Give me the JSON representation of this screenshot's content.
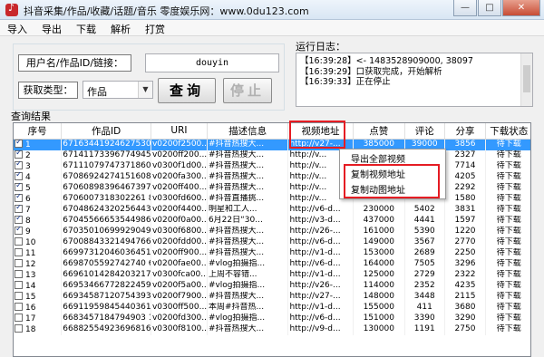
{
  "window": {
    "title": "抖音采集/作品/收藏/话题/音乐    零度娱乐网：www.0du123.com",
    "controls": [
      "—",
      "□",
      "✕"
    ]
  },
  "menu": [
    "导入",
    "导出",
    "下载",
    "解析",
    "打赏"
  ],
  "form": {
    "url_label": "用户名/作品ID/链接：",
    "url_value": "douyin",
    "type_label": "获取类型：",
    "type_value": "作品",
    "query_button": "查询",
    "stop_button": "停止"
  },
  "log": {
    "caption": "运行日志：",
    "lines": [
      "【16:39:28】<- 1483528909000, 38097",
      "【16:39:29】口获取完成，开始解析",
      "【16:39:33】正在停止"
    ]
  },
  "results": {
    "caption": "查询结果",
    "columns": [
      "序号",
      "作品ID",
      "URI",
      "描述信息",
      "视频地址",
      "点赞",
      "评论",
      "分享",
      "下载状态"
    ],
    "rows": [
      {
        "idx": "1",
        "checked": true,
        "id": "6716344192462753035",
        "uri": "v0200f2500...",
        "desc": "#抖音热搜大...",
        "url": "http://v27-...",
        "likes": "385000",
        "comments": "39000",
        "shares": "3856",
        "status": "待下载",
        "selected": true
      },
      {
        "idx": "2",
        "checked": true,
        "id": "6714117339677494536",
        "uri": "v0200ff200...",
        "desc": "#抖音热搜大...",
        "url": "http://v...",
        "likes": "",
        "comments": "",
        "shares": "2327",
        "status": "待下载"
      },
      {
        "idx": "3",
        "checked": true,
        "id": "6711107974737186055",
        "uri": "v0300f1d00...",
        "desc": "#抖音热搜大...",
        "url": "http://v...",
        "likes": "",
        "comments": "",
        "shares": "7714",
        "status": "待下载"
      },
      {
        "idx": "4",
        "checked": true,
        "id": "6708692427415160844",
        "uri": "v0200fa300...",
        "desc": "#抖音热搜大...",
        "url": "http://v...",
        "likes": "",
        "comments": "",
        "shares": "4205",
        "status": "待下载"
      },
      {
        "idx": "5",
        "checked": true,
        "id": "6706089839646739724",
        "uri": "v0200ff400...",
        "desc": "#抖音热搜大...",
        "url": "http://v...",
        "likes": "",
        "comments": "",
        "shares": "2292",
        "status": "待下载"
      },
      {
        "idx": "6",
        "checked": true,
        "id": "6706007318302261 83",
        "uri": "v0300fd600...",
        "desc": "#抖音直播挑...",
        "url": "http://v...",
        "likes": "",
        "comments": "",
        "shares": "1580",
        "status": "待下载"
      },
      {
        "idx": "7",
        "checked": true,
        "id": "6704862432025644301",
        "uri": "v0200f4400...",
        "desc": "明星和工人...",
        "url": "http://v6-d...",
        "likes": "230000",
        "comments": "5402",
        "shares": "3831",
        "status": "待下载"
      },
      {
        "idx": "8",
        "checked": true,
        "id": "6704556665354498600",
        "uri": "v0200f0a00...",
        "desc": "6月22日“30...",
        "url": "http://v3-d...",
        "likes": "437000",
        "comments": "4441",
        "shares": "1597",
        "status": "待下载"
      },
      {
        "idx": "9",
        "checked": true,
        "id": "6703501069992904973",
        "uri": "v0300f6800...",
        "desc": "#抖音热搜大...",
        "url": "http://v26-...",
        "likes": "161000",
        "comments": "5390",
        "shares": "1220",
        "status": "待下载"
      },
      {
        "idx": "10",
        "checked": false,
        "id": "6700884332149476622",
        "uri": "v0200fdd00...",
        "desc": "#抖音热搜大...",
        "url": "http://v6-d...",
        "likes": "149000",
        "comments": "3567",
        "shares": "2770",
        "status": "待下载"
      },
      {
        "idx": "11",
        "checked": false,
        "id": "6699731204603645187",
        "uri": "v0200ff900...",
        "desc": "#抖音热搜大...",
        "url": "http://v1-d...",
        "likes": "153000",
        "comments": "2689",
        "shares": "2250",
        "status": "待下载"
      },
      {
        "idx": "12",
        "checked": false,
        "id": "6698705592742740 60",
        "uri": "v0200fae00...",
        "desc": "#vlog拍摄指...",
        "url": "http://v6-d...",
        "likes": "164000",
        "comments": "7505",
        "shares": "3296",
        "status": "待下载"
      },
      {
        "idx": "13",
        "checked": false,
        "id": "6696101428420321796",
        "uri": "v0300fca00...",
        "desc": "上周不容错...",
        "url": "http://v1-d...",
        "likes": "125000",
        "comments": "2729",
        "shares": "2322",
        "status": "待下载"
      },
      {
        "idx": "14",
        "checked": false,
        "id": "6695346677282245902",
        "uri": "v0200f5a00...",
        "desc": "#vlog拍摄指...",
        "url": "http://v26-...",
        "likes": "114000",
        "comments": "2352",
        "shares": "4235",
        "status": "待下载"
      },
      {
        "idx": "15",
        "checked": false,
        "id": "6693458712075439364",
        "uri": "v0200f7900...",
        "desc": "#抖音热搜大...",
        "url": "http://v27-...",
        "likes": "148000",
        "comments": "3448",
        "shares": "2115",
        "status": "待下载"
      },
      {
        "idx": "16",
        "checked": false,
        "id": "6691195984544036109",
        "uri": "v0300ff500...",
        "desc": "本周#抖音热...",
        "url": "http://v1-d...",
        "likes": "155000",
        "comments": "411",
        "shares": "3680",
        "status": "待下载"
      },
      {
        "idx": "17",
        "checked": false,
        "id": "6683457184794903 18",
        "uri": "v0200fd300...",
        "desc": "#vlog拍摄指...",
        "url": "http://v6-d...",
        "likes": "151000",
        "comments": "3390",
        "shares": "3290",
        "status": "待下载"
      },
      {
        "idx": "18",
        "checked": false,
        "id": "6688255492369681676",
        "uri": "v0300f8100...",
        "desc": "#抖音热搜大...",
        "url": "http://v9-d...",
        "likes": "130000",
        "comments": "1191",
        "shares": "2750",
        "status": "待下载"
      }
    ]
  },
  "context_menu": {
    "items": [
      "导出全部视频",
      "复制视频地址",
      "复制动图地址"
    ]
  },
  "colors": {
    "selection": "#3399ff",
    "highlight_border": "#e51c23",
    "close_button": "#c74c35"
  }
}
